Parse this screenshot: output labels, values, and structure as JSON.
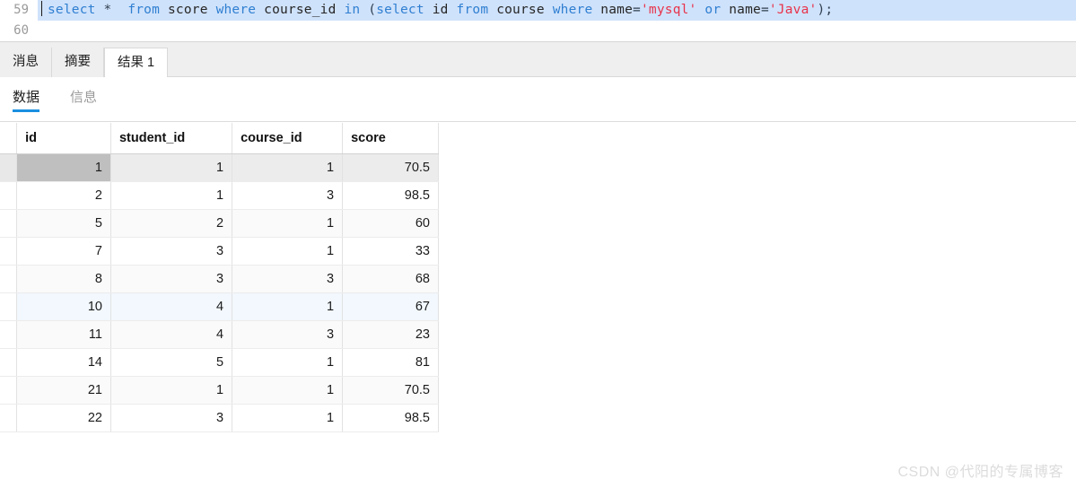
{
  "editor": {
    "lines": [
      {
        "number": "59",
        "selected": true,
        "tokens": [
          {
            "t": "kw",
            "s": "select"
          },
          {
            "t": "pun",
            "s": " * "
          },
          {
            "t": "kw",
            "s": " from"
          },
          {
            "t": "idn",
            "s": " score "
          },
          {
            "t": "kw",
            "s": "where"
          },
          {
            "t": "idn",
            "s": " course_id "
          },
          {
            "t": "kw",
            "s": "in"
          },
          {
            "t": "pun",
            "s": " ("
          },
          {
            "t": "kw",
            "s": "select"
          },
          {
            "t": "idn",
            "s": " id "
          },
          {
            "t": "kw",
            "s": "from"
          },
          {
            "t": "idn",
            "s": " course "
          },
          {
            "t": "kw",
            "s": "where"
          },
          {
            "t": "idn",
            "s": " name"
          },
          {
            "t": "pun",
            "s": "="
          },
          {
            "t": "str",
            "s": "'mysql'"
          },
          {
            "t": "kw",
            "s": " or"
          },
          {
            "t": "idn",
            "s": " name"
          },
          {
            "t": "pun",
            "s": "="
          },
          {
            "t": "str",
            "s": "'Java'"
          },
          {
            "t": "pun",
            "s": ");"
          }
        ]
      },
      {
        "number": "60",
        "selected": false,
        "tokens": []
      }
    ],
    "sql_text": "select *  from score where course_id in (select id from course where name='mysql' or name='Java');"
  },
  "result_tabs": [
    {
      "label": "消息",
      "active": false
    },
    {
      "label": "摘要",
      "active": false
    },
    {
      "label": "结果 1",
      "active": true
    }
  ],
  "sub_tabs": [
    {
      "label": "数据",
      "active": true
    },
    {
      "label": "信息",
      "active": false
    }
  ],
  "grid": {
    "columns": [
      "id",
      "student_id",
      "course_id",
      "score"
    ],
    "selected_column": "id",
    "selected_row_index": 0,
    "hover_row_index": 5,
    "rows": [
      [
        "1",
        "1",
        "1",
        "70.5"
      ],
      [
        "2",
        "1",
        "3",
        "98.5"
      ],
      [
        "5",
        "2",
        "1",
        "60"
      ],
      [
        "7",
        "3",
        "1",
        "33"
      ],
      [
        "8",
        "3",
        "3",
        "68"
      ],
      [
        "10",
        "4",
        "1",
        "67"
      ],
      [
        "11",
        "4",
        "3",
        "23"
      ],
      [
        "14",
        "5",
        "1",
        "81"
      ],
      [
        "21",
        "1",
        "1",
        "70.5"
      ],
      [
        "22",
        "3",
        "1",
        "98.5"
      ]
    ]
  },
  "watermark": {
    "text": "CSDN @代阳的专属博客"
  },
  "colors": {
    "keyword": "#2f7fd1",
    "string": "#e8334a",
    "identifier": "#262626",
    "selection": "#cfe2fb",
    "accent_underline": "#1a8fe0",
    "selected_cell": "#bfbfbf",
    "hover_row": "#f2f8fd"
  }
}
